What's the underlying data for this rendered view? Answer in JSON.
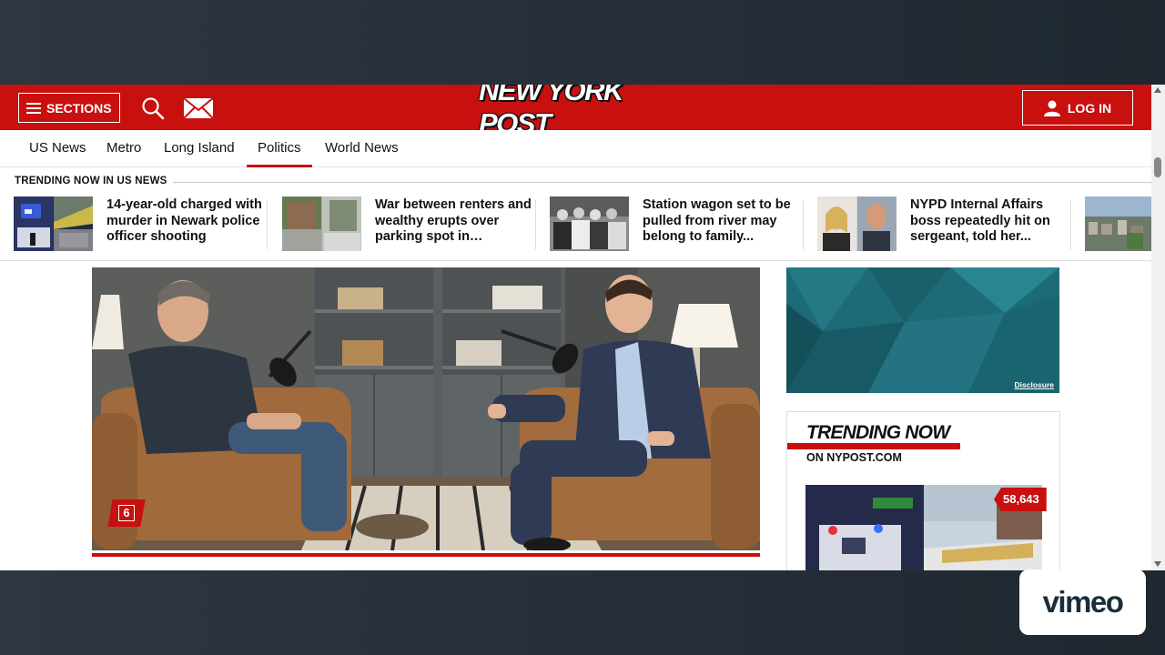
{
  "header": {
    "sections_label": "SECTIONS",
    "logo_text": "NEW YORK POST",
    "login_label": "LOG IN",
    "brand_color": "#c8100f"
  },
  "nav": {
    "items": [
      {
        "label": "US News"
      },
      {
        "label": "Metro"
      },
      {
        "label": "Long Island"
      },
      {
        "label": "Politics"
      },
      {
        "label": "World News"
      }
    ],
    "active": "Politics"
  },
  "trending_strip": {
    "label": "TRENDING NOW IN US NEWS",
    "items": [
      {
        "headline": "14-year-old charged with murder in Newark police officer shooting"
      },
      {
        "headline": "War between renters and wealthy erupts over parking spot in…"
      },
      {
        "headline": "Station wagon set to be pulled from river may belong to family..."
      },
      {
        "headline": "NYPD Internal Affairs boss repeatedly hit on sergeant, told her..."
      }
    ]
  },
  "hero": {
    "gallery_count": "6"
  },
  "ad": {
    "disclosure_label": "Disclosure"
  },
  "trending_box": {
    "title": "TRENDING NOW",
    "subtitle": "ON NYPOST.COM",
    "count": "58,643"
  },
  "vimeo": {
    "label": "vimeo"
  },
  "icons": [
    "hamburger-icon",
    "search-icon",
    "mail-icon",
    "user-icon"
  ]
}
